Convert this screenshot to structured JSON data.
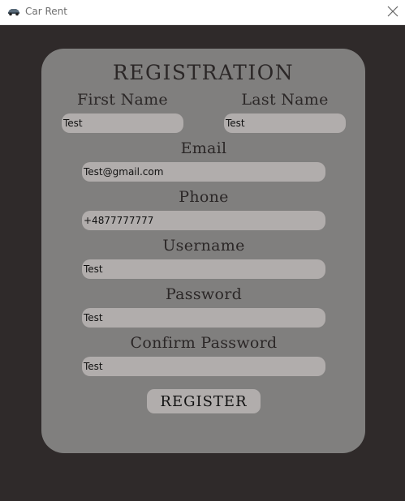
{
  "window": {
    "title": "Car Rent",
    "icon": "car-icon"
  },
  "form": {
    "heading": "REGISTRATION",
    "first_name": {
      "label": "First Name",
      "value": "Test"
    },
    "last_name": {
      "label": "Last Name",
      "value": "Test"
    },
    "email": {
      "label": "Email",
      "value": "Test@gmail.com"
    },
    "phone": {
      "label": "Phone",
      "value": "+4877777777"
    },
    "username": {
      "label": "Username",
      "value": "Test"
    },
    "password": {
      "label": "Password",
      "value": "Test"
    },
    "confirm_password": {
      "label": "Confirm Password",
      "value": "Test"
    },
    "register_label": "REGISTER"
  },
  "colors": {
    "background": "#2f2a2a",
    "panel": "#807f7e",
    "input": "#b1adac",
    "text": "#2b2727"
  }
}
